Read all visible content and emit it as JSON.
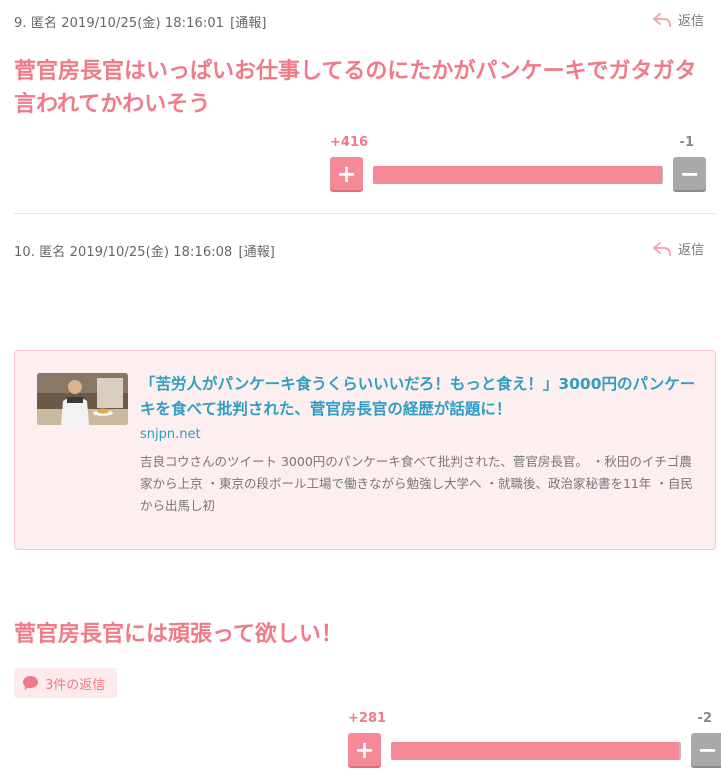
{
  "comments": [
    {
      "meta": "9. 匿名 2019/10/25(金) 18:16:01",
      "report_label": "[通報]",
      "reply_label": "返信",
      "body": "菅官房長官はいっぱいお仕事してるのにたかがパンケーキでガタガタ言われてかわいそう",
      "votes": {
        "plus": "+416",
        "minus": "-1",
        "plus_fraction": 0.998
      }
    },
    {
      "meta": "10. 匿名 2019/10/25(金) 18:16:08",
      "report_label": "[通報]",
      "reply_label": "返信",
      "link_card": {
        "title": "「苦労人がパンケーキ食うくらいいいだろ！もっと食え！」3000円のパンケーキを食べて批判された、菅官房長官の経歴が話題に！",
        "domain": "snjpn.net",
        "description": "吉良コウさんのツイート 3000円のパンケーキ食べて批判された、菅官房長官。 ・秋田のイチゴ農家から上京 ・東京の段ボール工場で働きながら勉強し大学へ ・就職後、政治家秘書を11年 ・自民から出馬し初"
      },
      "body": "菅官房長官には頑張って欲しい！",
      "reply_count_label": "3件の返信",
      "votes": {
        "plus": "+281",
        "minus": "-2",
        "plus_fraction": 0.993
      }
    }
  ],
  "icons": {
    "plus": "+",
    "minus": "−",
    "reply": "reply-arrow-icon",
    "speech": "speech-bubble-icon"
  },
  "colors": {
    "accent": "#f07a87",
    "link": "#2f9ec4",
    "vote_plus": "#f58a96",
    "vote_minus": "#a9a9a9"
  }
}
